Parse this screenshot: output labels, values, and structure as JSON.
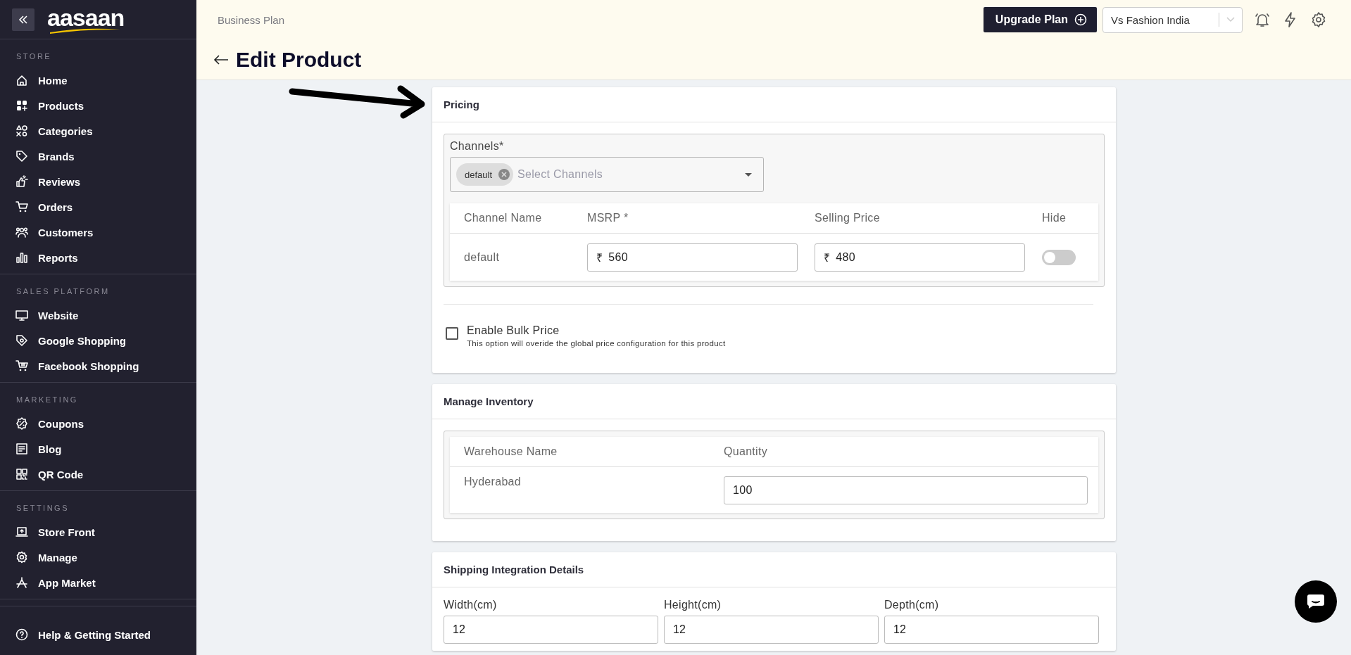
{
  "sidebar": {
    "logo": "aasaan",
    "sections": [
      {
        "title": "STORE",
        "items": [
          {
            "label": "Home"
          },
          {
            "label": "Products"
          },
          {
            "label": "Categories"
          },
          {
            "label": "Brands"
          },
          {
            "label": "Reviews"
          },
          {
            "label": "Orders"
          },
          {
            "label": "Customers"
          },
          {
            "label": "Reports"
          }
        ]
      },
      {
        "title": "SALES PLATFORM",
        "items": [
          {
            "label": "Website"
          },
          {
            "label": "Google Shopping"
          },
          {
            "label": "Facebook Shopping"
          }
        ]
      },
      {
        "title": "MARKETING",
        "items": [
          {
            "label": "Coupons"
          },
          {
            "label": "Blog"
          },
          {
            "label": "QR Code"
          }
        ]
      },
      {
        "title": "SETTINGS",
        "items": [
          {
            "label": "Store Front"
          },
          {
            "label": "Manage"
          },
          {
            "label": "App Market"
          }
        ]
      }
    ],
    "footer_item": {
      "label": "Help & Getting Started"
    }
  },
  "header": {
    "plan": "Business Plan",
    "upgrade_button": "Upgrade Plan",
    "store_select": "Vs Fashion India",
    "page_title": "Edit Product"
  },
  "pricing": {
    "title": "Pricing",
    "channels_label": "Channels*",
    "chips": [
      "default"
    ],
    "placeholder": "Select Channels",
    "table": {
      "columns": [
        "Channel Name",
        "MSRP *",
        "Selling Price",
        "Hide"
      ],
      "rows": [
        {
          "name": "default",
          "msrp": {
            "currency": "₹",
            "value": "560"
          },
          "selling_price": {
            "currency": "₹",
            "value": "480"
          },
          "hide": false
        }
      ]
    },
    "bulk_price": {
      "label": "Enable Bulk Price",
      "hint": "This option will overide the global price configuration for this product",
      "checked": false
    }
  },
  "inventory": {
    "title": "Manage Inventory",
    "columns": [
      "Warehouse Name",
      "Quantity"
    ],
    "rows": [
      {
        "name": "Hyderabad",
        "quantity": "100"
      }
    ]
  },
  "shipping": {
    "title": "Shipping Integration Details",
    "fields": [
      {
        "label": "Width(cm)",
        "value": "12"
      },
      {
        "label": "Height(cm)",
        "value": "12"
      },
      {
        "label": "Depth(cm)",
        "value": "12"
      }
    ]
  }
}
